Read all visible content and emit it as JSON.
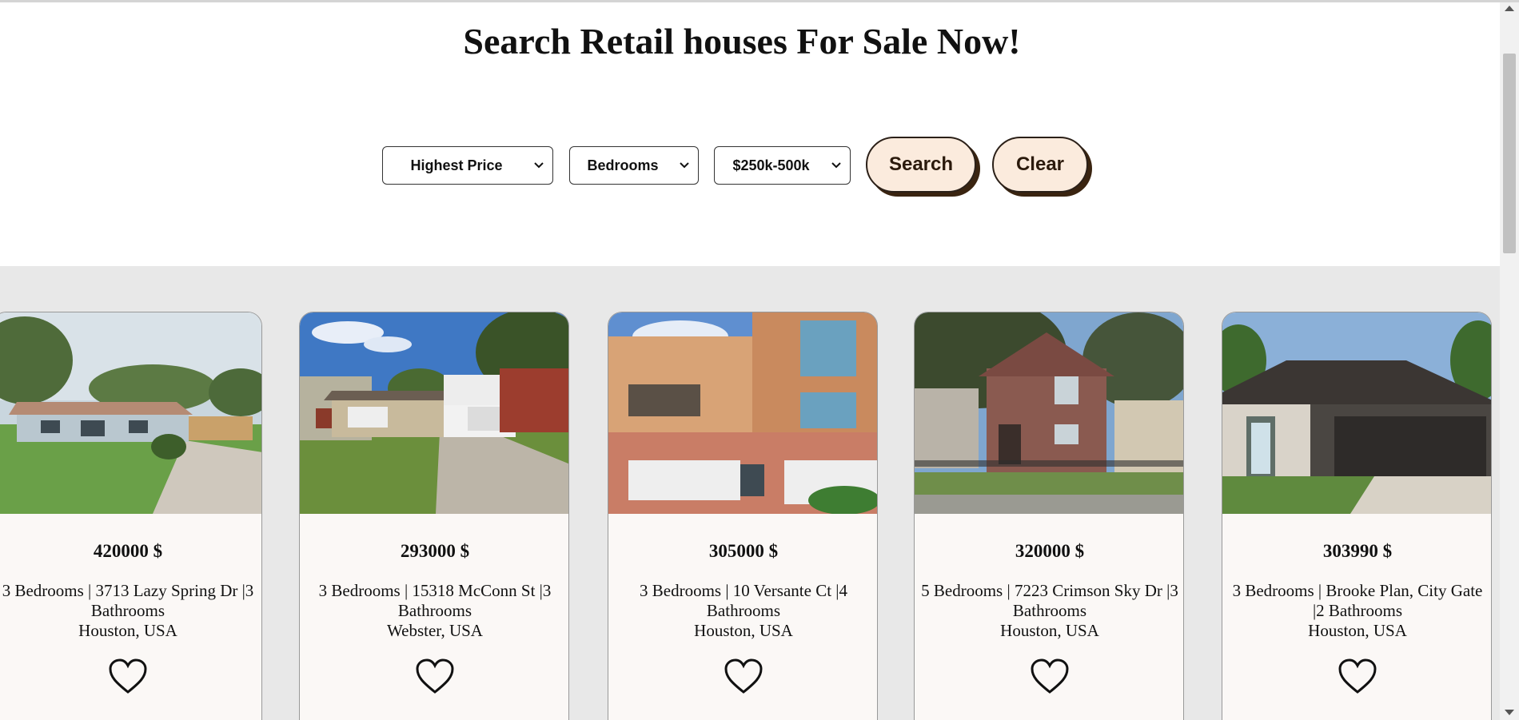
{
  "page": {
    "title": "Search Retail houses For Sale Now!"
  },
  "filters": {
    "sort": {
      "value": "Highest Price"
    },
    "bedrooms": {
      "value": "Bedrooms"
    },
    "price_range": {
      "value": "$250k-500k"
    },
    "search_label": "Search",
    "clear_label": "Clear"
  },
  "listings": [
    {
      "price": "420000 $",
      "line1": "3 Bedrooms | 3713 Lazy Spring Dr |3",
      "line2": "Bathrooms",
      "location": "Houston, USA"
    },
    {
      "price": "293000 $",
      "line1": "3 Bedrooms | 15318 McConn St |3",
      "line2": "Bathrooms",
      "location": "Webster, USA"
    },
    {
      "price": "305000 $",
      "line1": "3 Bedrooms | 10 Versante Ct |4",
      "line2": "Bathrooms",
      "location": "Houston, USA"
    },
    {
      "price": "320000 $",
      "line1": "5 Bedrooms | 7223 Crimson Sky Dr |3",
      "line2": "Bathrooms",
      "location": "Houston, USA"
    },
    {
      "price": "303990 $",
      "line1": "3 Bedrooms | Brooke Plan, City Gate",
      "line2": "|2 Bathrooms",
      "location": "Houston, USA"
    }
  ],
  "icons": {
    "favorite": "heart-outline-icon",
    "dropdown": "chevron-down-icon"
  },
  "colors": {
    "button_bg": "#fbebdd",
    "button_shadow": "#3a2410",
    "listing_bg": "#e8e8e8",
    "card_bg": "#fbf8f6"
  }
}
